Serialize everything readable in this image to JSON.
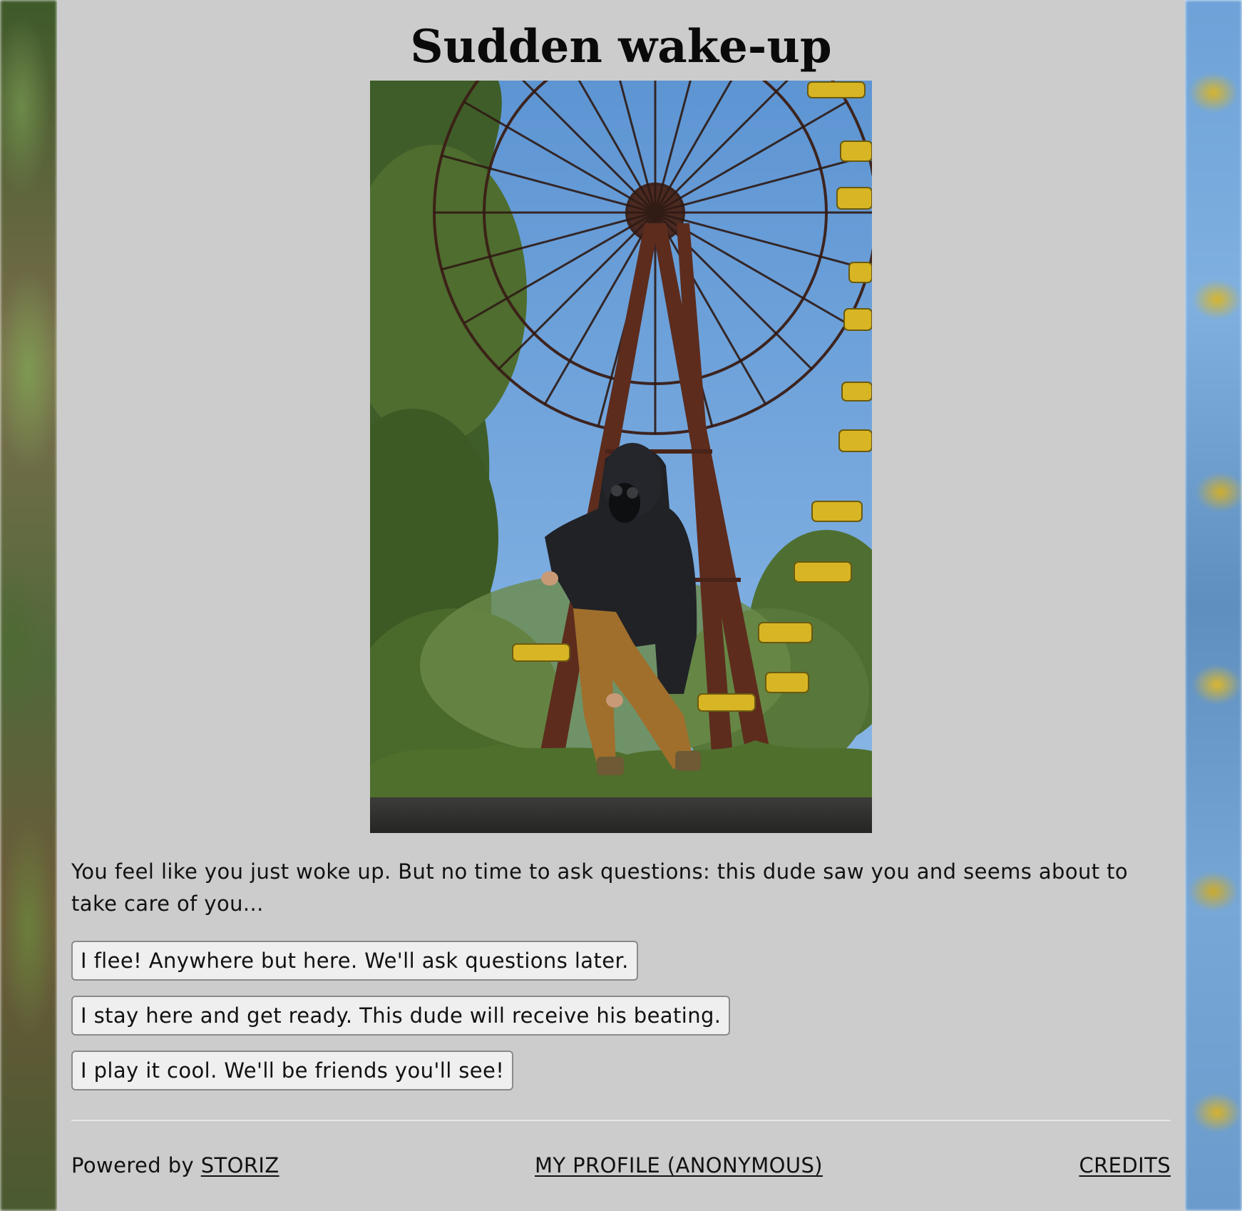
{
  "story": {
    "title": "Sudden wake-up",
    "image_alt": "Person in a gas mask in front of an abandoned ferris wheel",
    "text": "You feel like you just woke up. But no time to ask questions: this dude saw you and seems about to take care of you...",
    "choices": [
      {
        "label": "I flee! Anywhere but here. We'll ask questions later."
      },
      {
        "label": "I stay here and get ready. This dude will receive his beating."
      },
      {
        "label": "I play it cool. We'll be friends you'll see!"
      }
    ]
  },
  "footer": {
    "powered_prefix": "Powered by ",
    "powered_link": "STORIZ",
    "profile_link": "MY PROFILE (ANONYMOUS)",
    "credits_link": "CREDITS"
  },
  "colors": {
    "panel_background": "#cccccc",
    "button_background": "#efefef",
    "button_border": "#8a8a8a",
    "text": "#111111",
    "sky": "#6fa3da",
    "foliage": "#4e6b2e",
    "wheel_frame": "#5a2a1c",
    "gondola": "#d8b524"
  }
}
